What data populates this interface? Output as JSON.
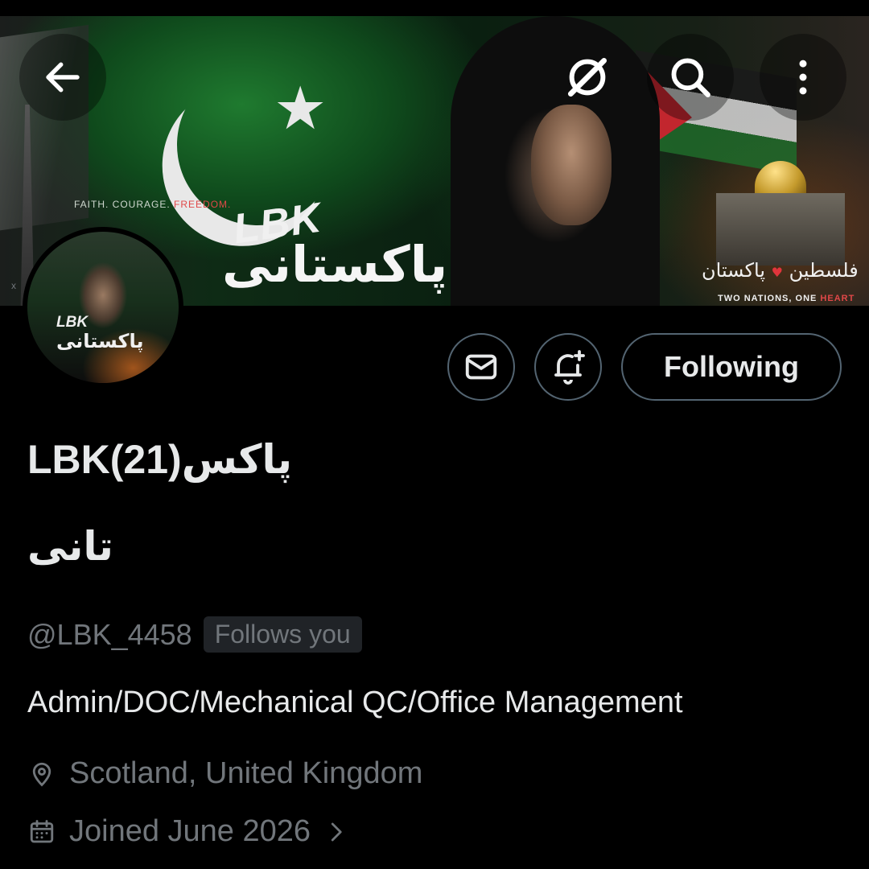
{
  "header": {
    "back_icon": "arrow-left-icon",
    "grok_icon": "grok-icon",
    "search_icon": "search-icon",
    "more_icon": "more-vertical-icon"
  },
  "banner": {
    "tagline_prefix": "FAITH. COURAGE.",
    "tagline_highlight": "FREEDOM.",
    "title_latin": "LBK",
    "title_urdu": "پاکستانی",
    "nations_urdu_right": "فلسطین",
    "nations_urdu_left": "پاکستان",
    "nations_text": "TWO NATIONS, ONE",
    "nations_highlight": "HEART"
  },
  "avatar": {
    "text_latin": "LBK",
    "text_urdu": "پاکستانی",
    "corner_mark": "x"
  },
  "actions": {
    "message_icon": "mail-icon",
    "notify_icon": "bell-plus-icon",
    "following_label": "Following"
  },
  "profile": {
    "display_name_line1": "LBK(21)پاکس",
    "display_name_line2": "تانی",
    "handle": "@LBK_4458",
    "follows_you": "Follows you",
    "bio": "Admin/DOC/Mechanical QC/Office Management",
    "location": "Scotland, United Kingdom",
    "joined": "Joined June 2026"
  },
  "colors": {
    "background": "#000000",
    "primary_text": "#e7e9ea",
    "secondary_text": "#71767b",
    "button_border": "#536471",
    "badge_bg": "#202327"
  }
}
